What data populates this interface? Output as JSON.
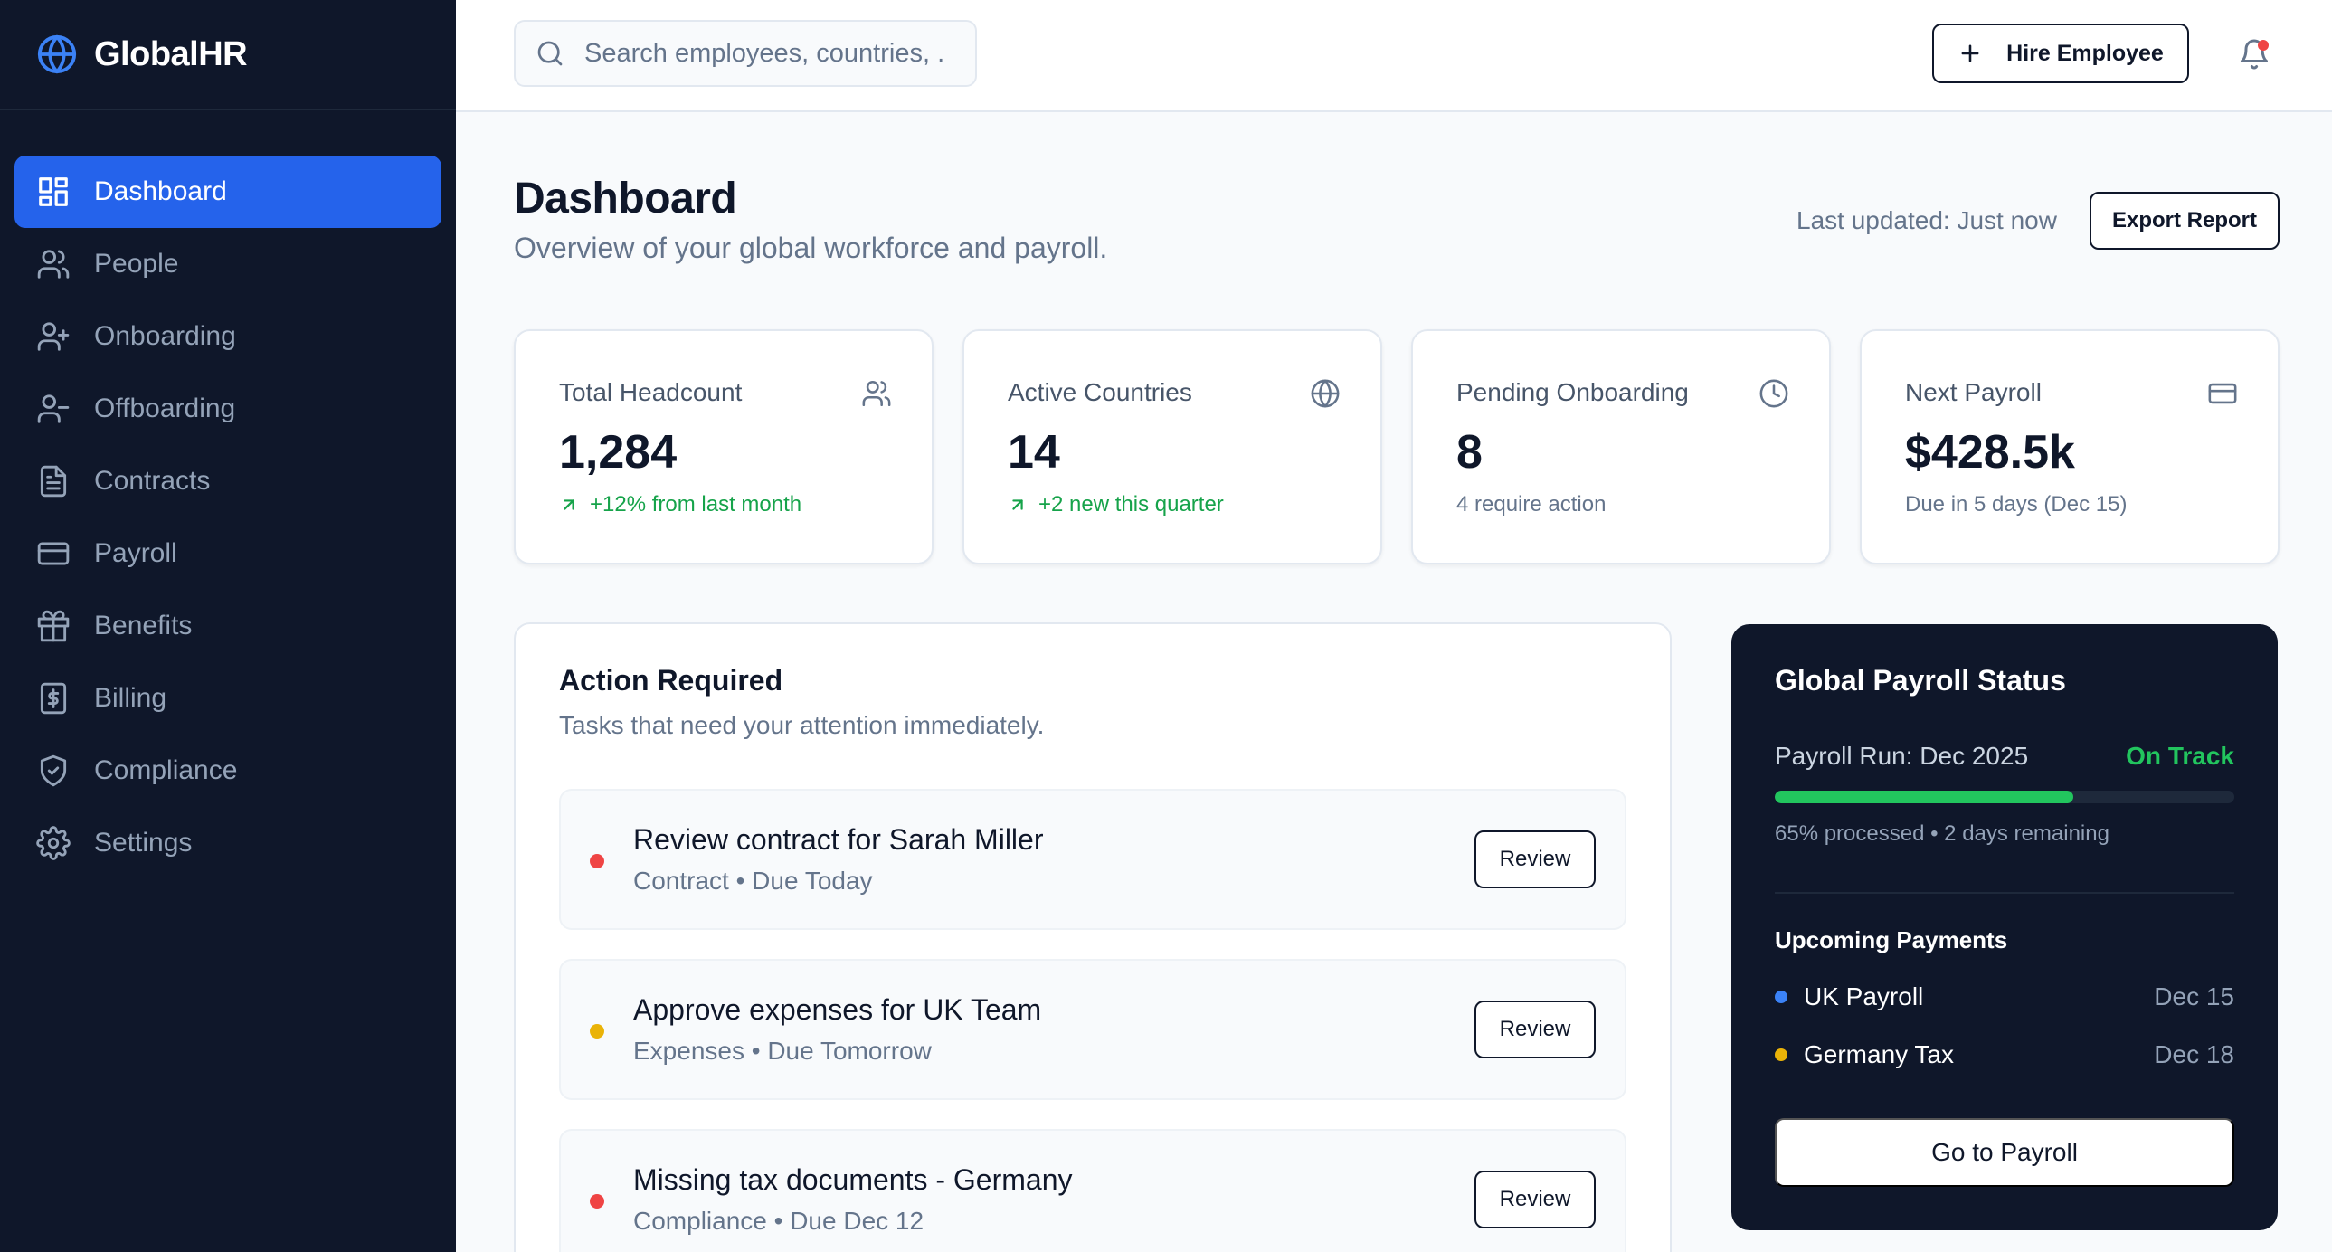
{
  "brand": {
    "name": "GlobalHR",
    "color": "#3b82f6"
  },
  "sidebar": {
    "items": [
      {
        "label": "Dashboard",
        "icon": "dashboard-icon",
        "active": true
      },
      {
        "label": "People",
        "icon": "people-icon"
      },
      {
        "label": "Onboarding",
        "icon": "user-plus-icon"
      },
      {
        "label": "Offboarding",
        "icon": "user-minus-icon"
      },
      {
        "label": "Contracts",
        "icon": "file-icon"
      },
      {
        "label": "Payroll",
        "icon": "credit-card-icon"
      },
      {
        "label": "Benefits",
        "icon": "gift-icon"
      },
      {
        "label": "Billing",
        "icon": "dollar-receipt-icon"
      },
      {
        "label": "Compliance",
        "icon": "shield-icon"
      },
      {
        "label": "Settings",
        "icon": "gear-icon"
      }
    ]
  },
  "topbar": {
    "search_placeholder": "Search employees, countries, ...",
    "hire_label": "Hire Employee"
  },
  "header": {
    "title": "Dashboard",
    "subtitle": "Overview of your global workforce and payroll.",
    "last_updated": "Last updated: Just now",
    "export_label": "Export Report"
  },
  "stats": [
    {
      "label": "Total Headcount",
      "value": "1,284",
      "note": "+12% from last month",
      "trend": "up",
      "icon": "users-icon"
    },
    {
      "label": "Active Countries",
      "value": "14",
      "note": "+2 new this quarter",
      "trend": "up",
      "icon": "globe-icon"
    },
    {
      "label": "Pending Onboarding",
      "value": "8",
      "note": "4 require action",
      "trend": "none",
      "icon": "clock-icon"
    },
    {
      "label": "Next Payroll",
      "value": "$428.5k",
      "note": "Due in 5 days (Dec 15)",
      "trend": "none",
      "icon": "credit-card-icon"
    }
  ],
  "actions": {
    "title": "Action Required",
    "subtitle": "Tasks that need your attention immediately.",
    "items": [
      {
        "title": "Review contract for Sarah Miller",
        "meta": "Contract • Due Today",
        "priority_color": "#ef4444",
        "button": "Review"
      },
      {
        "title": "Approve expenses for UK Team",
        "meta": "Expenses • Due Tomorrow",
        "priority_color": "#eab308",
        "button": "Review"
      },
      {
        "title": "Missing tax documents - Germany",
        "meta": "Compliance • Due Dec 12",
        "priority_color": "#ef4444",
        "button": "Review"
      }
    ]
  },
  "payroll_status": {
    "title": "Global Payroll Status",
    "run_label": "Payroll Run: Dec 2025",
    "status": "On Track",
    "progress_percent": 65,
    "progress_note": "65% processed • 2 days remaining",
    "upcoming_title": "Upcoming Payments",
    "payments": [
      {
        "name": "UK Payroll",
        "date": "Dec 15",
        "color": "#3b82f6"
      },
      {
        "name": "Germany Tax",
        "date": "Dec 18",
        "color": "#eab308"
      }
    ],
    "button": "Go to Payroll"
  }
}
